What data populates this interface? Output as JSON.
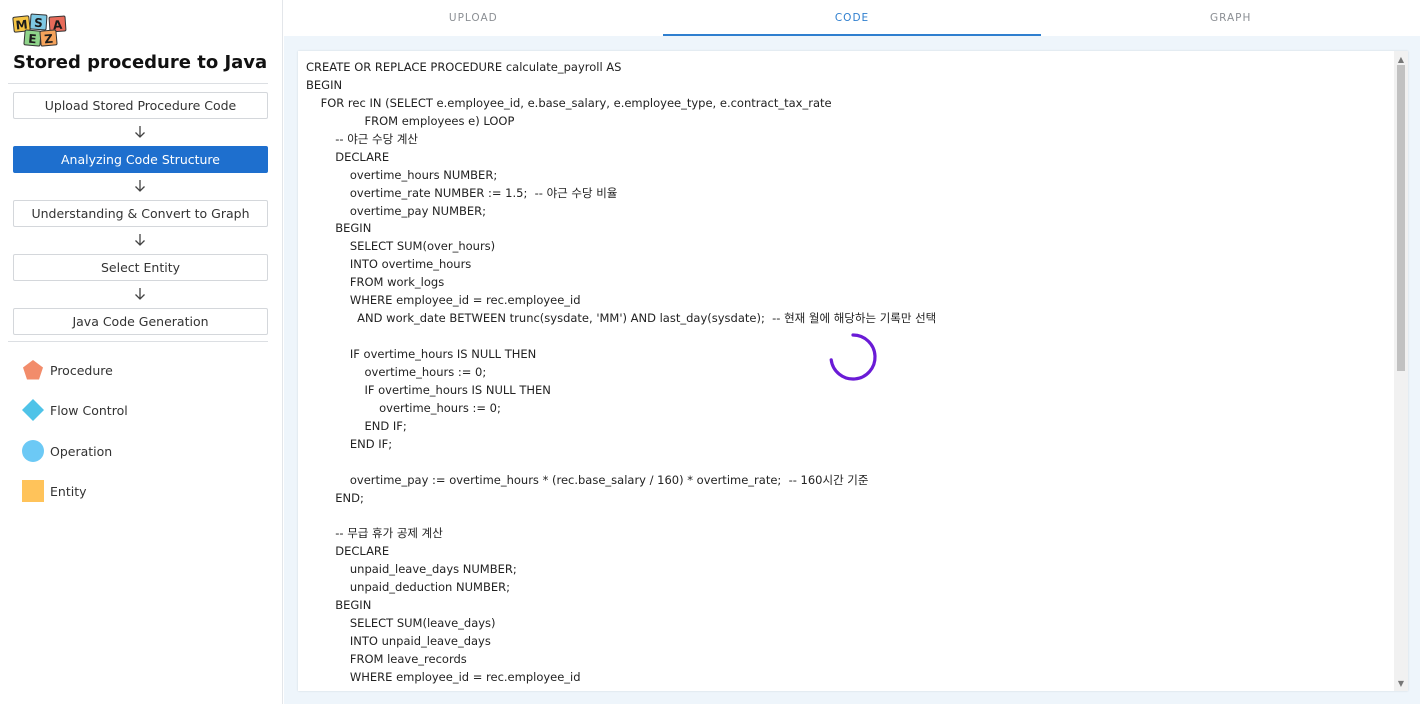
{
  "app": {
    "logo_letters": [
      "M",
      "S",
      "A",
      "E",
      "Z"
    ],
    "title": "Stored procedure to Java"
  },
  "steps": [
    {
      "label": "Upload Stored Procedure Code",
      "active": false
    },
    {
      "label": "Analyzing Code Structure",
      "active": true
    },
    {
      "label": "Understanding & Convert to Graph",
      "active": false
    },
    {
      "label": "Select Entity",
      "active": false
    },
    {
      "label": "Java Code Generation",
      "active": false
    }
  ],
  "legend": [
    {
      "label": "Procedure",
      "shape": "pentagon",
      "color": "#f28c6b"
    },
    {
      "label": "Flow Control",
      "shape": "diamond",
      "color": "#4fc3e8"
    },
    {
      "label": "Operation",
      "shape": "circle",
      "color": "#6cc9f5"
    },
    {
      "label": "Entity",
      "shape": "square",
      "color": "#ffc35a"
    }
  ],
  "tabs": [
    {
      "label": "UPLOAD",
      "active": false
    },
    {
      "label": "CODE",
      "active": true
    },
    {
      "label": "GRAPH",
      "active": false
    }
  ],
  "colors": {
    "accent": "#1e6fce",
    "tab_active": "#2f7fcf",
    "spinner": "#6a1bd6"
  },
  "code_lines": [
    "CREATE OR REPLACE PROCEDURE calculate_payroll AS",
    "BEGIN",
    "    FOR rec IN (SELECT e.employee_id, e.base_salary, e.employee_type, e.contract_tax_rate",
    "                FROM employees e) LOOP",
    "        -- 야근 수당 계산",
    "        DECLARE",
    "            overtime_hours NUMBER;",
    "            overtime_rate NUMBER := 1.5;  -- 야근 수당 비율",
    "            overtime_pay NUMBER;",
    "        BEGIN",
    "            SELECT SUM(over_hours)",
    "            INTO overtime_hours",
    "            FROM work_logs",
    "            WHERE employee_id = rec.employee_id",
    "              AND work_date BETWEEN trunc(sysdate, 'MM') AND last_day(sysdate);  -- 현재 월에 해당하는 기록만 선택",
    "",
    "            IF overtime_hours IS NULL THEN",
    "                overtime_hours := 0;",
    "                IF overtime_hours IS NULL THEN",
    "                    overtime_hours := 0;",
    "                END IF;",
    "            END IF;",
    "",
    "            overtime_pay := overtime_hours * (rec.base_salary / 160) * overtime_rate;  -- 160시간 기준",
    "        END;",
    "",
    "        -- 무급 휴가 공제 계산",
    "        DECLARE",
    "            unpaid_leave_days NUMBER;",
    "            unpaid_deduction NUMBER;",
    "        BEGIN",
    "            SELECT SUM(leave_days)",
    "            INTO unpaid_leave_days",
    "            FROM leave_records",
    "            WHERE employee_id = rec.employee_id"
  ]
}
